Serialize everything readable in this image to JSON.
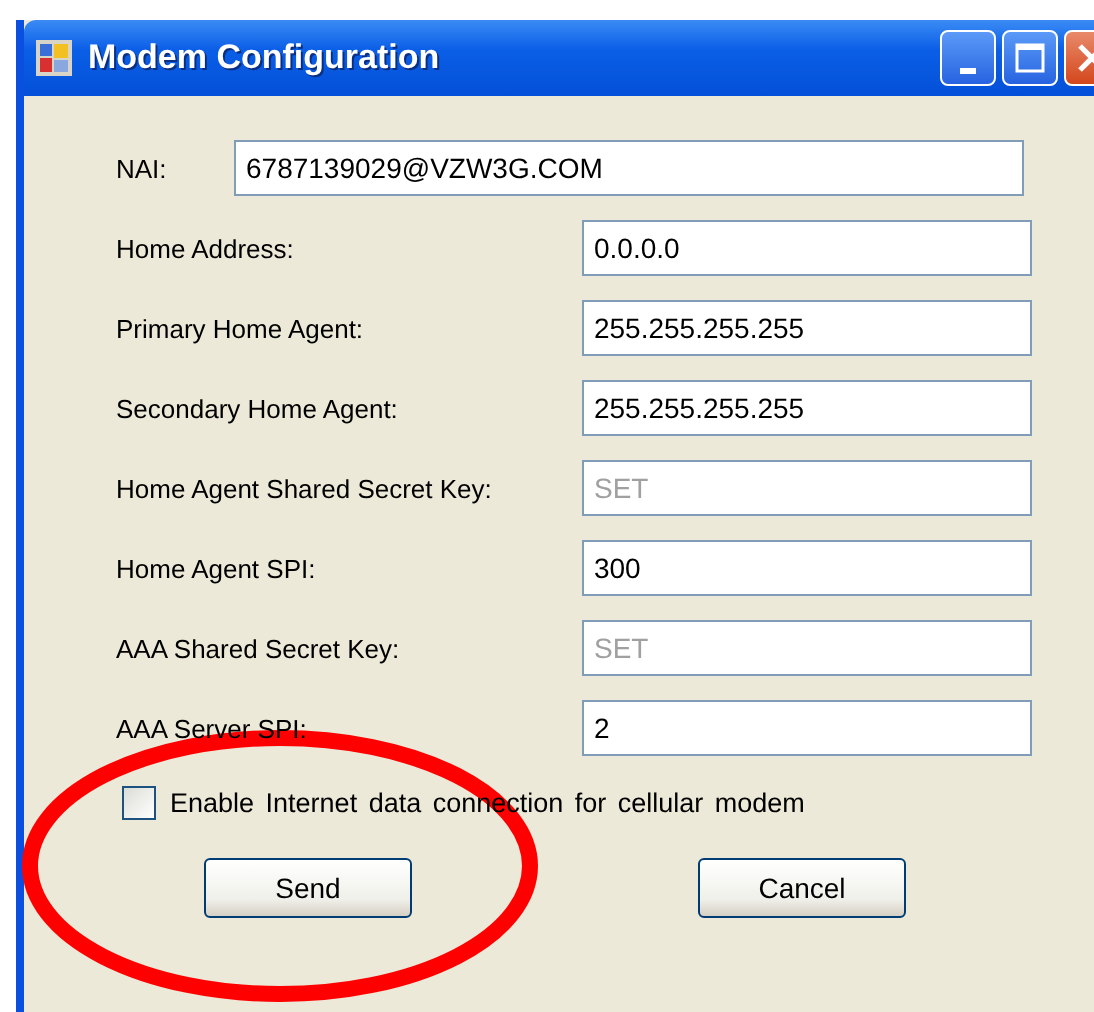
{
  "window": {
    "title": "Modem Configuration"
  },
  "fields": [
    {
      "kind": "wide",
      "label": "NAI:",
      "value": "6787139029@VZW3G.COM",
      "disabled": false
    },
    {
      "kind": "narrow",
      "label": "Home Address:",
      "value": "0.0.0.0",
      "disabled": false
    },
    {
      "kind": "narrow",
      "label": "Primary Home Agent:",
      "value": "255.255.255.255",
      "disabled": false
    },
    {
      "kind": "narrow",
      "label": "Secondary Home Agent:",
      "value": "255.255.255.255",
      "disabled": false
    },
    {
      "kind": "narrow",
      "label": "Home Agent Shared Secret Key:",
      "value": "SET",
      "disabled": true
    },
    {
      "kind": "narrow",
      "label": "Home Agent SPI:",
      "value": "300",
      "disabled": false
    },
    {
      "kind": "narrow",
      "label": "AAA Shared Secret Key:",
      "value": "SET",
      "disabled": true
    },
    {
      "kind": "narrow",
      "label": "AAA Server SPI:",
      "value": "2",
      "disabled": false
    }
  ],
  "checkbox": {
    "label": "Enable Internet data connection for cellular modem",
    "checked": false
  },
  "buttons": [
    "Send",
    "Cancel"
  ]
}
